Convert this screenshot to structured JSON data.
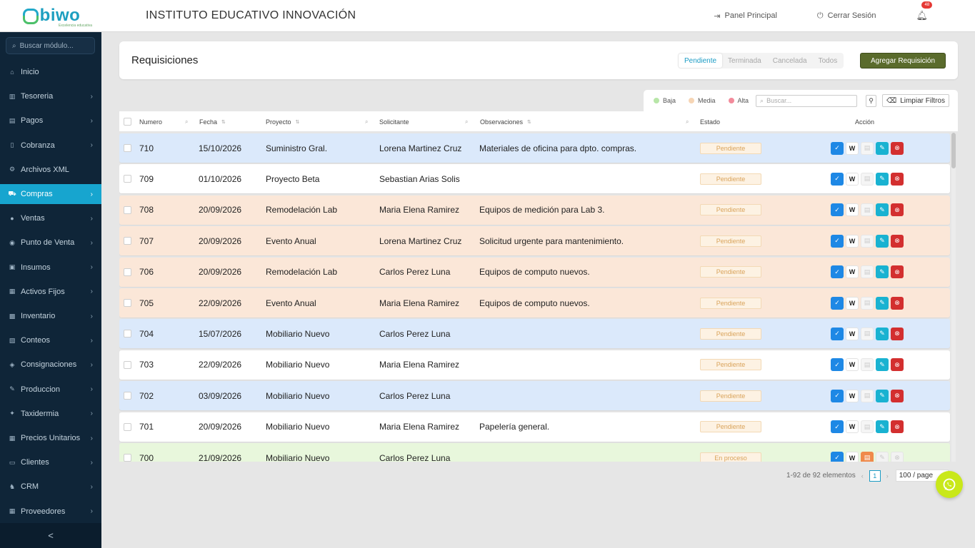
{
  "header": {
    "logo_text": "biwo",
    "logo_sub": "Excelencia educativa",
    "title": "INSTITUTO EDUCATIVO INNOVACIÓN",
    "panel_label": "Panel Principal",
    "logout_label": "Cerrar Sesión",
    "notifications_count": "48"
  },
  "sidebar": {
    "search_placeholder": "Buscar módulo...",
    "items": [
      {
        "label": "Inicio",
        "icon": "home-icon",
        "arrow": false
      },
      {
        "label": "Tesoreria",
        "icon": "bank-icon",
        "arrow": true
      },
      {
        "label": "Pagos",
        "icon": "payment-icon",
        "arrow": true
      },
      {
        "label": "Cobranza",
        "icon": "document-icon",
        "arrow": true
      },
      {
        "label": "Archivos XML",
        "icon": "xml-icon",
        "arrow": false
      },
      {
        "label": "Compras",
        "icon": "cart-icon",
        "arrow": true,
        "active": true
      },
      {
        "label": "Ventas",
        "icon": "sales-icon",
        "arrow": true
      },
      {
        "label": "Punto de Venta",
        "icon": "pos-icon",
        "arrow": true
      },
      {
        "label": "Insumos",
        "icon": "supplies-icon",
        "arrow": true
      },
      {
        "label": "Activos Fijos",
        "icon": "assets-icon",
        "arrow": true
      },
      {
        "label": "Inventario",
        "icon": "inventory-icon",
        "arrow": true
      },
      {
        "label": "Conteos",
        "icon": "count-icon",
        "arrow": true
      },
      {
        "label": "Consignaciones",
        "icon": "consignment-icon",
        "arrow": true
      },
      {
        "label": "Produccion",
        "icon": "production-icon",
        "arrow": true
      },
      {
        "label": "Taxidermia",
        "icon": "taxidermy-icon",
        "arrow": true
      },
      {
        "label": "Precios Unitarios",
        "icon": "price-icon",
        "arrow": true
      },
      {
        "label": "Clientes",
        "icon": "clients-icon",
        "arrow": true
      },
      {
        "label": "CRM",
        "icon": "crm-icon",
        "arrow": true
      },
      {
        "label": "Proveedores",
        "icon": "suppliers-icon",
        "arrow": true
      }
    ],
    "collapse_label": "<"
  },
  "page": {
    "title": "Requisiciones",
    "tabs": [
      "Pendiente",
      "Terminada",
      "Cancelada",
      "Todos"
    ],
    "active_tab": "Pendiente",
    "add_button": "Agregar Requisición"
  },
  "filters": {
    "legend": [
      {
        "label": "Baja",
        "color": "#b8e6a8"
      },
      {
        "label": "Media",
        "color": "#f6d5b5"
      },
      {
        "label": "Alta",
        "color": "#f28b9b"
      }
    ],
    "search_placeholder": "Buscar...",
    "clear_label": "Limpiar Filtros"
  },
  "table": {
    "columns": [
      "Numero",
      "Fecha",
      "Proyecto",
      "Solicitante",
      "Observaciones",
      "Estado",
      "Acción"
    ],
    "rows": [
      {
        "numero": "710",
        "fecha": "15/10/2026",
        "proyecto": "Suministro Gral.",
        "solicitante": "Lorena Martinez Cruz",
        "observaciones": "Materiales de oficina para dpto. compras.",
        "estado": "Pendiente",
        "color": "#dbe9fb",
        "final": false
      },
      {
        "numero": "709",
        "fecha": "01/10/2026",
        "proyecto": "Proyecto Beta",
        "solicitante": "Sebastian Arias Solis",
        "observaciones": "",
        "estado": "Pendiente",
        "color": "#ffffff",
        "final": false
      },
      {
        "numero": "708",
        "fecha": "20/09/2026",
        "proyecto": "Remodelación Lab",
        "solicitante": "Maria Elena Ramirez",
        "observaciones": "Equipos de medición para Lab 3.",
        "estado": "Pendiente",
        "color": "#fbe7d8",
        "final": false
      },
      {
        "numero": "707",
        "fecha": "20/09/2026",
        "proyecto": "Evento Anual",
        "solicitante": "Lorena Martinez Cruz",
        "observaciones": "Solicitud urgente para mantenimiento.",
        "estado": "Pendiente",
        "color": "#fbe7d8",
        "final": false
      },
      {
        "numero": "706",
        "fecha": "20/09/2026",
        "proyecto": "Remodelación Lab",
        "solicitante": "Carlos Perez Luna",
        "observaciones": "Equipos de computo nuevos.",
        "estado": "Pendiente",
        "color": "#fbe7d8",
        "final": false
      },
      {
        "numero": "705",
        "fecha": "22/09/2026",
        "proyecto": "Evento Anual",
        "solicitante": "Maria Elena Ramirez",
        "observaciones": "Equipos de computo nuevos.",
        "estado": "Pendiente",
        "color": "#fbe7d8",
        "final": false
      },
      {
        "numero": "704",
        "fecha": "15/07/2026",
        "proyecto": "Mobiliario Nuevo",
        "solicitante": "Carlos Perez Luna",
        "observaciones": "",
        "estado": "Pendiente",
        "color": "#dbe9fb",
        "final": false
      },
      {
        "numero": "703",
        "fecha": "22/09/2026",
        "proyecto": "Mobiliario Nuevo",
        "solicitante": "Maria Elena Ramirez",
        "observaciones": "",
        "estado": "Pendiente",
        "color": "#ffffff",
        "final": false
      },
      {
        "numero": "702",
        "fecha": "03/09/2026",
        "proyecto": "Mobiliario Nuevo",
        "solicitante": "Carlos Perez Luna",
        "observaciones": "",
        "estado": "Pendiente",
        "color": "#dbe9fb",
        "final": false
      },
      {
        "numero": "701",
        "fecha": "20/09/2026",
        "proyecto": "Mobiliario Nuevo",
        "solicitante": "Maria Elena Ramirez",
        "observaciones": "Papelería general.",
        "estado": "Pendiente",
        "color": "#ffffff",
        "final": false
      },
      {
        "numero": "700",
        "fecha": "21/09/2026",
        "proyecto": "Mobiliario Nuevo",
        "solicitante": "Carlos Perez Luna",
        "observaciones": "",
        "estado": "En proceso",
        "color": "#e8f7dc",
        "final": true
      }
    ]
  },
  "pagination": {
    "summary": "1-92 de 92 elementos",
    "current_page": "1",
    "page_size": "100 / page"
  },
  "colors": {
    "sidebar_bg": "#0f2538",
    "accent": "#17a5cf",
    "add_button": "#5a6b2c",
    "fab": "#c9e81a"
  }
}
